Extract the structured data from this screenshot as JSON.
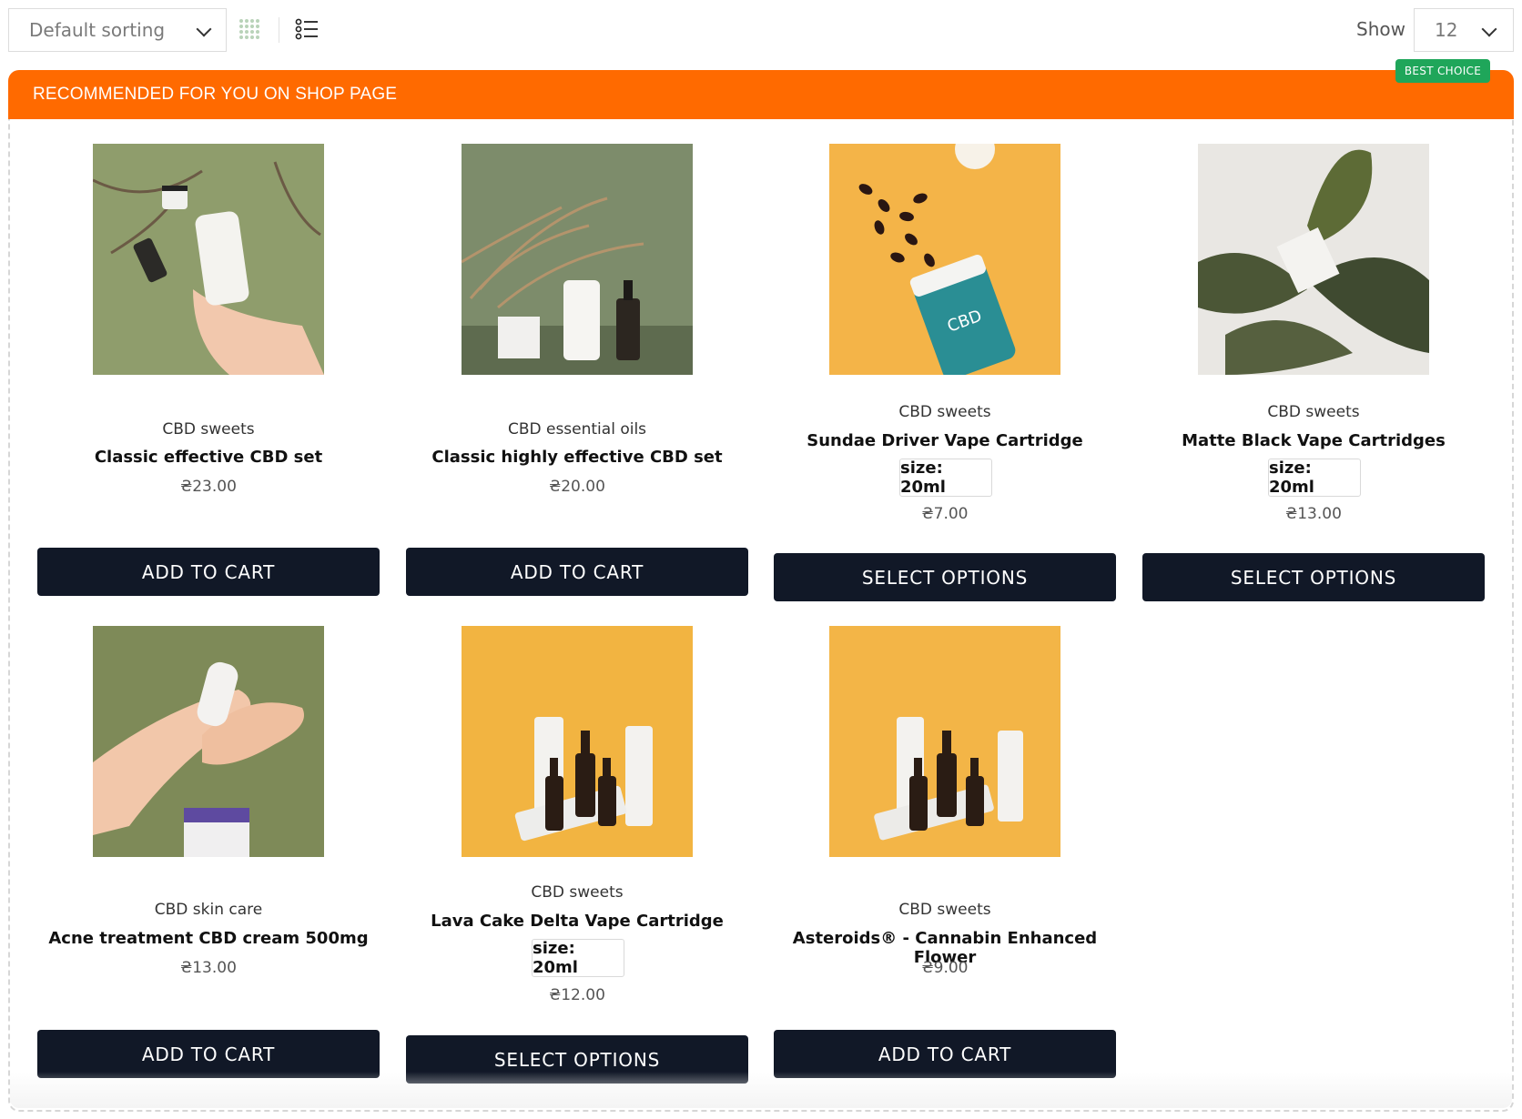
{
  "toolbar": {
    "sort_value": "Default sorting",
    "show_label": "Show",
    "per_page": "12"
  },
  "recommendation": {
    "title": "RECOMMENDED FOR YOU ON SHOP PAGE",
    "badge": "BEST CHOICE"
  },
  "products": [
    {
      "category": "CBD sweets",
      "title": "Classic effective CBD set",
      "price": "₴23.00",
      "button": "ADD TO CART"
    },
    {
      "category": "CBD essential oils",
      "title": "Classic highly effective CBD set",
      "price": "₴20.00",
      "button": "ADD TO CART"
    },
    {
      "category": "CBD sweets",
      "title": "Sundae Driver Vape Cartridge",
      "option": "size: 20ml",
      "price": "₴7.00",
      "button": "SELECT OPTIONS"
    },
    {
      "category": "CBD sweets",
      "title": "Matte Black Vape Cartridges",
      "option": "size: 20ml",
      "price": "₴13.00",
      "button": "SELECT OPTIONS"
    },
    {
      "category": "CBD skin care",
      "title": "Acne treatment CBD cream 500mg",
      "price": "₴13.00",
      "button": "ADD TO CART"
    },
    {
      "category": "CBD sweets",
      "title": "Lava Cake Delta Vape Cartridge",
      "option": "size: 20ml",
      "price": "₴12.00",
      "button": "SELECT OPTIONS"
    },
    {
      "category": "CBD sweets",
      "title": "Asteroids® - Cannabin Enhanced Flower",
      "price": "₴9.00",
      "button": "ADD TO CART"
    }
  ],
  "colors": {
    "header_orange": "#ff6a00",
    "badge_green": "#1fa65a",
    "button_dark": "#111827"
  }
}
